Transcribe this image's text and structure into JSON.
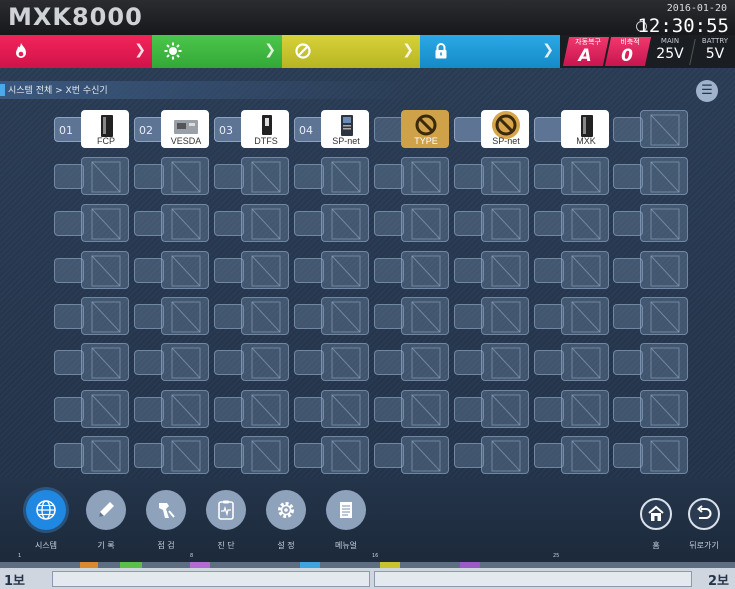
{
  "header": {
    "logo": "MXK8000",
    "date": "2016-01-20",
    "time": "12:30:55"
  },
  "status": {
    "mode_auto_label": "자동복구",
    "mode_auto_value": "A",
    "mode_stop_label": "비축적",
    "mode_stop_value": "0",
    "main_label": "MAIN",
    "main_value": "25V",
    "battery_label": "BATTRY",
    "battery_value": "5V",
    "colors": {
      "fire": "#e81d52",
      "supervisory": "#3fb741",
      "fault": "#c9c42d",
      "lock": "#1f9ad6"
    }
  },
  "breadcrumb": "시스템 전체 > X번 수신기",
  "devices": [
    {
      "num": "01",
      "label": "FCP",
      "icon": "cabinet-icon"
    },
    {
      "num": "02",
      "label": "VESDA",
      "icon": "vesda-icon"
    },
    {
      "num": "03",
      "label": "DTFS",
      "icon": "dtfs-icon"
    },
    {
      "num": "04",
      "label": "SP-net",
      "icon": "spnet-icon"
    },
    {
      "num": "",
      "label": "TYPE",
      "icon": "no-entry-icon"
    },
    {
      "num": "",
      "label": "SP-net",
      "icon": "no-entry-icon"
    },
    {
      "num": "",
      "label": "MXK",
      "icon": "cabinet-icon"
    }
  ],
  "bottom_nav": [
    {
      "label": "시스템",
      "icon": "globe-icon"
    },
    {
      "label": "기 록",
      "icon": "pencil-icon"
    },
    {
      "label": "점 검",
      "icon": "inspect-icon"
    },
    {
      "label": "진 단",
      "icon": "clipboard-icon"
    },
    {
      "label": "설 정",
      "icon": "gear-icon"
    },
    {
      "label": "메뉴얼",
      "icon": "manual-icon"
    }
  ],
  "home_label": "홈",
  "back_label": "뒤로가기",
  "floor_left": "1보",
  "floor_right": "2보",
  "timeline_numbers": [
    "1",
    "8",
    "16",
    "25"
  ]
}
